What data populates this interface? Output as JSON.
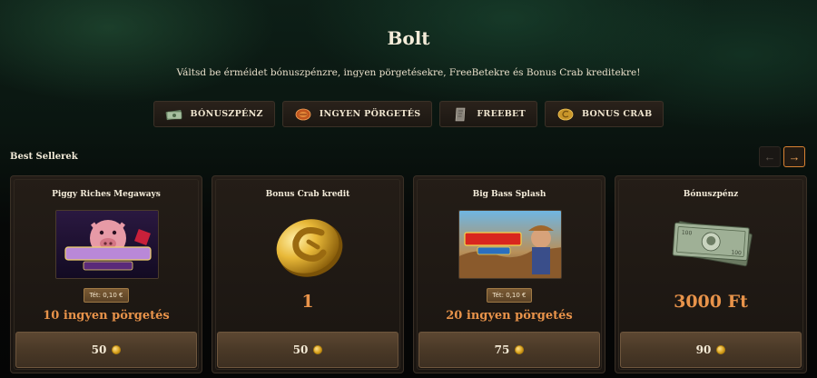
{
  "page": {
    "title": "Bolt",
    "subtitle": "Váltsd be érméidet bónuszpénzre, ingyen pörgetésekre, FreeBetekre és Bonus Crab kreditekre!"
  },
  "tabs": [
    {
      "label": "BÓNUSZPÉNZ",
      "icon": "banknote-icon"
    },
    {
      "label": "INGYEN PÖRGETÉS",
      "icon": "spins-icon"
    },
    {
      "label": "FREEBET",
      "icon": "ticket-icon"
    },
    {
      "label": "BONUS CRAB",
      "icon": "crab-coin-icon"
    }
  ],
  "best_sellers": {
    "title": "Best Sellerek",
    "prev_icon": "arrow-left-icon",
    "next_icon": "arrow-right-icon"
  },
  "cards": [
    {
      "title": "Piggy Riches Megaways",
      "bet": "Tét: 0,10 €",
      "value": "10 ingyen pörgetés",
      "price": "50",
      "image": "piggy-riches-megaways-thumbnail"
    },
    {
      "title": "Bonus Crab kredit",
      "value": "1",
      "price": "50",
      "image": "crab-coin-image"
    },
    {
      "title": "Big Bass Splash",
      "bet": "Tét: 0,10 €",
      "value": "20 ingyen pörgetés",
      "price": "75",
      "image": "big-bass-splash-thumbnail"
    },
    {
      "title": "Bónuszpénz",
      "value": "3000 Ft",
      "price": "90",
      "image": "banknotes-image"
    }
  ],
  "colors": {
    "accent": "#e8934a",
    "background": "#050505",
    "card": "#1f1914"
  }
}
